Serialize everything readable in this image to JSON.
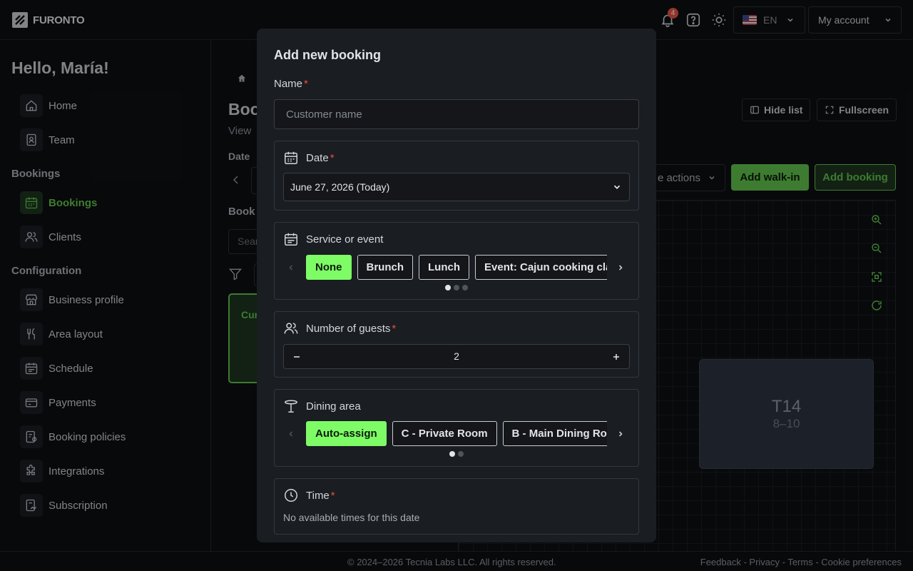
{
  "header": {
    "brand": "FURONTO",
    "notifications_count": "4",
    "language": "EN",
    "account_label": "My account"
  },
  "sidebar": {
    "greeting": "Hello, María!",
    "items_top": [
      {
        "label": "Home",
        "icon": "home-icon"
      },
      {
        "label": "Team",
        "icon": "team-icon"
      }
    ],
    "bookings_section": "Bookings",
    "items_bookings": [
      {
        "label": "Bookings",
        "icon": "calendar-icon",
        "active": true
      },
      {
        "label": "Clients",
        "icon": "clients-icon"
      }
    ],
    "configuration_section": "Configuration",
    "items_config": [
      {
        "label": "Business profile",
        "icon": "store-icon"
      },
      {
        "label": "Area layout",
        "icon": "cutlery-icon"
      },
      {
        "label": "Schedule",
        "icon": "schedule-icon"
      },
      {
        "label": "Payments",
        "icon": "card-icon"
      },
      {
        "label": "Booking policies",
        "icon": "policy-icon"
      },
      {
        "label": "Integrations",
        "icon": "puzzle-icon"
      },
      {
        "label": "Subscription",
        "icon": "subscription-icon"
      }
    ]
  },
  "main": {
    "title_partial": "Boo",
    "subtitle_partial": "View",
    "date_label": "Date",
    "bookings_label_partial": "Book",
    "search_partial": "Sear",
    "card_partial": "Cur",
    "hide_list": "Hide list",
    "fullscreen": "Fullscreen",
    "more_actions_partial": "e actions",
    "add_walk_in": "Add walk-in",
    "add_booking": "Add booking",
    "table": {
      "name": "T14",
      "capacity": "8–10"
    }
  },
  "modal": {
    "title": "Add new booking",
    "name_label": "Name",
    "name_placeholder": "Customer name",
    "name_value": "",
    "date_label": "Date",
    "date_value": "June 27, 2026 (Today)",
    "service_label": "Service or event",
    "services": [
      "None",
      "Brunch",
      "Lunch",
      "Event: Cajun cooking cla"
    ],
    "service_selected": "None",
    "guests_label": "Number of guests",
    "guests_value": "2",
    "area_label": "Dining area",
    "areas": [
      "Auto-assign",
      "C - Private Room",
      "B - Main Dining Roo"
    ],
    "area_selected": "Auto-assign",
    "time_label": "Time",
    "time_empty": "No available times for this date"
  },
  "footer": {
    "copyright": "© 2024–2026 Tecnia Labs LLC. All rights reserved.",
    "links": "Feedback - Privacy - Terms - Cookie preferences"
  },
  "colors": {
    "accent": "#5fbf4a",
    "chip_selected": "#7dfc66",
    "required": "#e25241",
    "modal_bg": "#1a1d21"
  }
}
